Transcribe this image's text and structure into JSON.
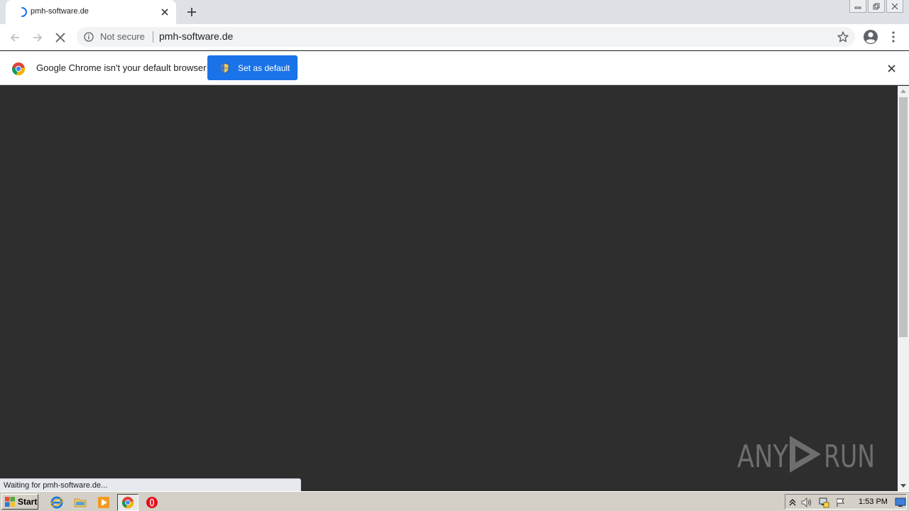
{
  "tab": {
    "title": "pmh-software.de"
  },
  "address_bar": {
    "security_label": "Not secure",
    "url": "pmh-software.de"
  },
  "infobar": {
    "message": "Google Chrome isn't your default browser",
    "button_label": "Set as default"
  },
  "status_bar": {
    "text": "Waiting for pmh-software.de..."
  },
  "watermark": {
    "left": "ANY",
    "right": "RUN"
  },
  "taskbar": {
    "start_label": "Start",
    "clock": "1:53 PM"
  },
  "colors": {
    "page_bg": "#2e2e2e",
    "accent": "#1a73e8",
    "tabstrip": "#dee1e6",
    "taskbar": "#d4d0c8"
  },
  "icons": [
    "loading-spinner-icon",
    "close-icon",
    "plus-icon",
    "back-arrow-icon",
    "forward-arrow-icon",
    "stop-icon",
    "info-icon",
    "star-icon",
    "profile-icon",
    "kebab-menu-icon",
    "chrome-logo-icon",
    "shield-icon",
    "windows-logo-icon",
    "internet-explorer-icon",
    "folder-icon",
    "media-player-icon",
    "chrome-icon",
    "opera-icon",
    "chevron-up-icon",
    "speaker-icon",
    "network-icon",
    "flag-icon",
    "desktop-icon"
  ]
}
